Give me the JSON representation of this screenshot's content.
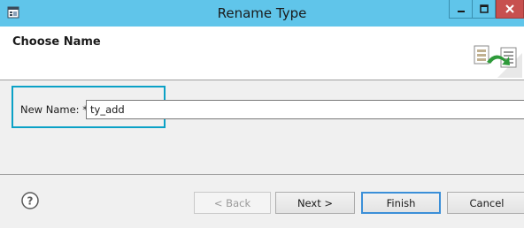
{
  "window": {
    "title": "Rename Type",
    "controls": {
      "minimize": "minimize",
      "maximize": "maximize",
      "close": "close"
    }
  },
  "header": {
    "title": "Choose Name",
    "icon": "rename-wizard-icon"
  },
  "form": {
    "new_name_label": "New Name: *",
    "new_name_value": "ty_add"
  },
  "footer": {
    "help_icon": "help-icon",
    "back_label": "< Back",
    "next_label": "Next >",
    "finish_label": "Finish",
    "cancel_label": "Cancel"
  },
  "colors": {
    "titlebar": "#60c5ea",
    "close_button": "#c7504f",
    "highlight_box": "#0ba1c6",
    "default_button_border": "#3b8fd8"
  }
}
